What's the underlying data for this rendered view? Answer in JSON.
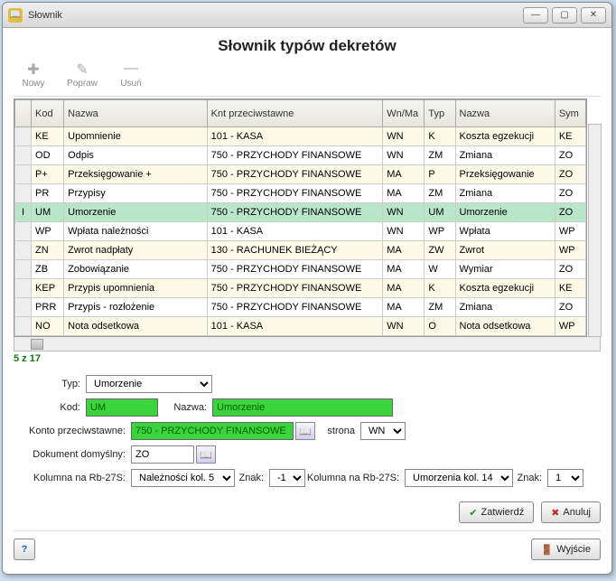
{
  "window": {
    "title": "Słownik"
  },
  "heading": "Słownik typów dekretów",
  "toolbar": {
    "new": "Nowy",
    "edit": "Popraw",
    "del": "Usuń"
  },
  "cols": {
    "kod": "Kod",
    "nazwa": "Nazwa",
    "knt": "Knt przeciwstawne",
    "wnma": "Wn/Ma",
    "typ": "Typ",
    "nazwa2": "Nazwa",
    "sym": "Sym"
  },
  "rows": [
    {
      "kod": "KE",
      "nazwa": "Upomnienie",
      "knt": "101 - KASA",
      "wnma": "WN",
      "typ": "K",
      "nazwa2": "Koszta egzekucji",
      "sym": "KE"
    },
    {
      "kod": "OD",
      "nazwa": "Odpis",
      "knt": "750 - PRZYCHODY FINANSOWE",
      "wnma": "WN",
      "typ": "ZM",
      "nazwa2": "Zmiana",
      "sym": "ZO"
    },
    {
      "kod": "P+",
      "nazwa": "Przeksięgowanie +",
      "knt": "750 - PRZYCHODY FINANSOWE",
      "wnma": "MA",
      "typ": "P",
      "nazwa2": "Przeksięgowanie",
      "sym": "ZO"
    },
    {
      "kod": "PR",
      "nazwa": "Przypisy",
      "knt": "750 - PRZYCHODY FINANSOWE",
      "wnma": "MA",
      "typ": "ZM",
      "nazwa2": "Zmiana",
      "sym": "ZO"
    },
    {
      "kod": "UM",
      "nazwa": "Umorzenie",
      "knt": "750 - PRZYCHODY FINANSOWE",
      "wnma": "WN",
      "typ": "UM",
      "nazwa2": "Umorzenie",
      "sym": "ZO"
    },
    {
      "kod": "WP",
      "nazwa": "Wpłata należności",
      "knt": "101 - KASA",
      "wnma": "WN",
      "typ": "WP",
      "nazwa2": "Wpłata",
      "sym": "WP"
    },
    {
      "kod": "ZN",
      "nazwa": "Zwrot nadpłaty",
      "knt": "130 - RACHUNEK BIEŻĄCY",
      "wnma": "MA",
      "typ": "ZW",
      "nazwa2": "Zwrot",
      "sym": "WP"
    },
    {
      "kod": "ZB",
      "nazwa": "Zobowiązanie",
      "knt": "750 - PRZYCHODY FINANSOWE",
      "wnma": "MA",
      "typ": "W",
      "nazwa2": "Wymiar",
      "sym": "ZO"
    },
    {
      "kod": "KEP",
      "nazwa": "Przypis upomnienia",
      "knt": "750 - PRZYCHODY FINANSOWE",
      "wnma": "MA",
      "typ": "K",
      "nazwa2": "Koszta egzekucji",
      "sym": "KE"
    },
    {
      "kod": "PRR",
      "nazwa": "Przypis - rozłożenie",
      "knt": "750 - PRZYCHODY FINANSOWE",
      "wnma": "MA",
      "typ": "ZM",
      "nazwa2": "Zmiana",
      "sym": "ZO"
    },
    {
      "kod": "NO",
      "nazwa": "Nota odsetkowa",
      "knt": "101 - KASA",
      "wnma": "WN",
      "typ": "O",
      "nazwa2": "Nota odsetkowa",
      "sym": "WP"
    }
  ],
  "selectedIndex": 4,
  "counter": "5 z 17",
  "form": {
    "labels": {
      "typ": "Typ:",
      "kod": "Kod:",
      "nazwa": "Nazwa:",
      "konto": "Konto przeciwstawne:",
      "strona": "strona",
      "dokument": "Dokument domyślny:",
      "rbs1": "Kolumna na Rb-27S:",
      "znak": "Znak:",
      "rbs2": "Kolumna na Rb-27S:"
    },
    "values": {
      "typ": "Umorzenie",
      "kod": "UM",
      "nazwa": "Umorzenie",
      "konto": "750 - PRZYCHODY FINANSOWE",
      "strona": "WN",
      "dokument": "ZO",
      "rbs1": "Należności kol. 5",
      "znak1": "-1",
      "rbs2": "Umorzenia kol. 14",
      "znak2": "1"
    }
  },
  "buttons": {
    "confirm": "Zatwierdź",
    "cancel": "Anuluj",
    "exit": "Wyjście"
  }
}
